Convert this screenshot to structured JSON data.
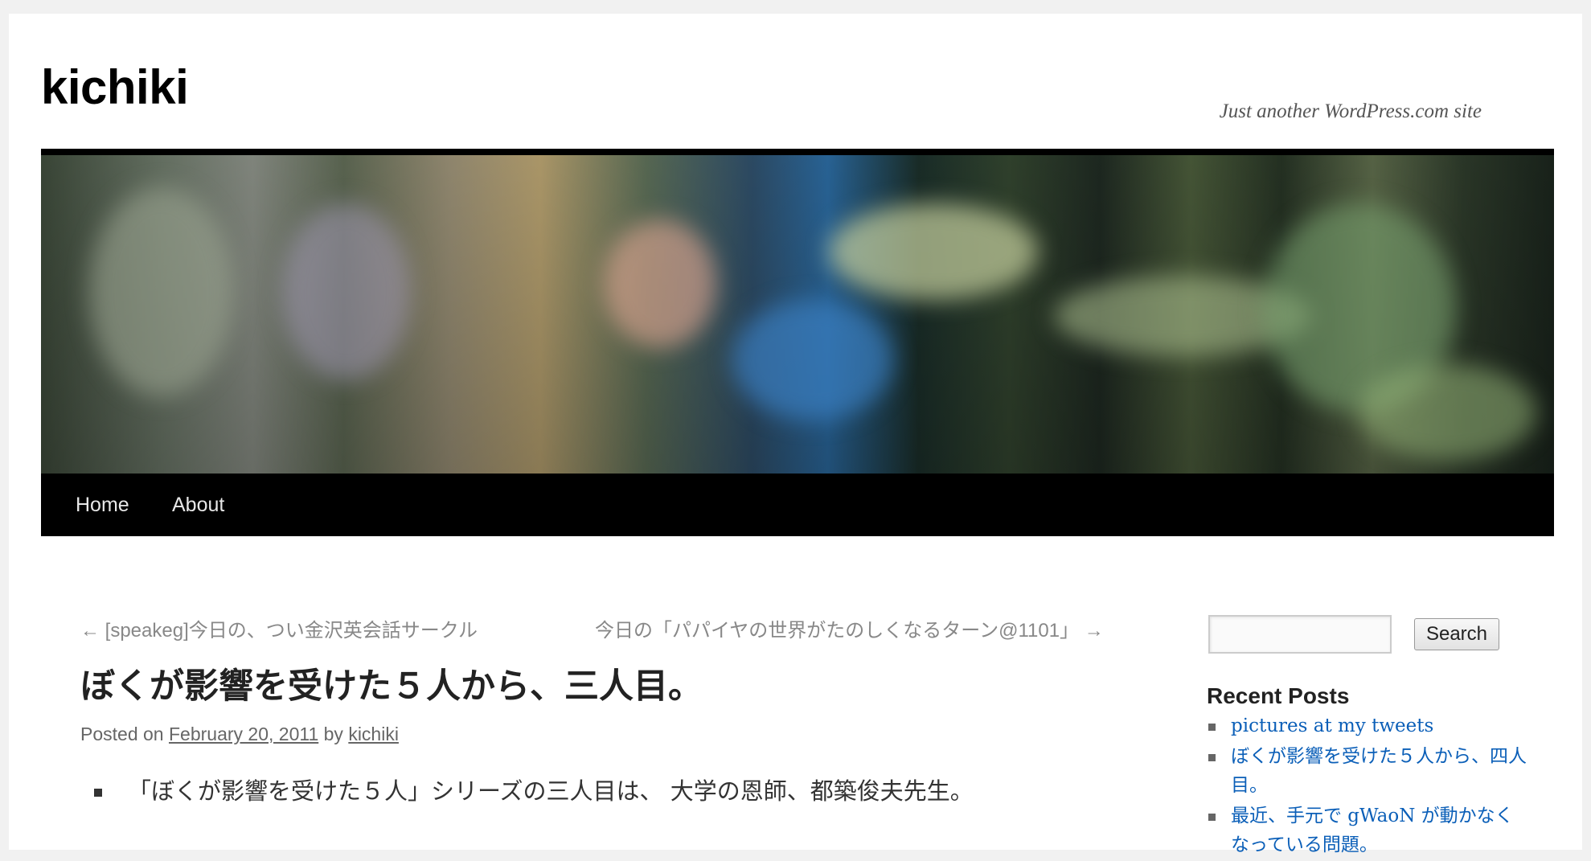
{
  "site": {
    "title": "kichiki",
    "description": "Just another WordPress.com site"
  },
  "nav": {
    "items": [
      {
        "label": "Home"
      },
      {
        "label": "About"
      }
    ]
  },
  "post_nav": {
    "previous": "← [speakeg]今日の、つい金沢英会話サークル",
    "next": "今日の「パパイヤの世界がたのしくなるターン@1101」 →"
  },
  "post": {
    "title": "ぼくが影響を受けた５人から、三人目。",
    "meta_prefix": "Posted on",
    "date": "February 20, 2011",
    "meta_by": "by",
    "author": "kichiki",
    "content_first_line": "「ぼくが影響を受けた５人」シリーズの三人目は、 大学の恩師、都築俊夫先生。"
  },
  "sidebar": {
    "search": {
      "button_label": "Search",
      "value": ""
    },
    "recent_posts_title": "Recent Posts",
    "recent_posts": [
      "pictures at my tweets",
      "ぼくが影響を受けた５人から、四人目。",
      "最近、手元で gWaoN が動かなくなっている問題。"
    ]
  },
  "colors": {
    "link": "#0b5fb8",
    "nav_bar": "#000000",
    "background": "#f1f1f1"
  }
}
